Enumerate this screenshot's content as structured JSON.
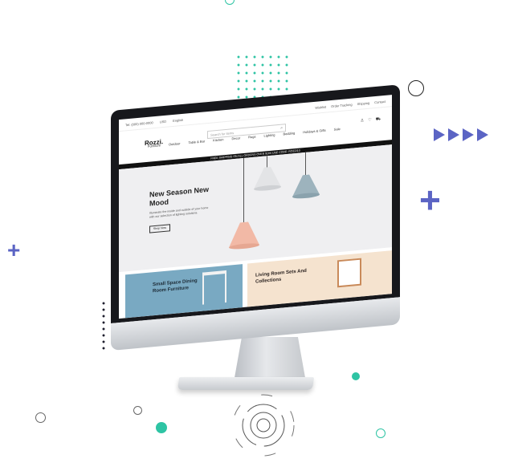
{
  "colors": {
    "accent_teal": "#2ec4a4",
    "accent_indigo": "#5b64c4",
    "dark": "#1f1f2e",
    "promo_bar": "#111111",
    "card_blue": "#79a9c2",
    "card_peach": "#f5e3cf"
  },
  "decor": {
    "x_mark": "✖",
    "plus": "+",
    "icons": [
      "close-icon",
      "plus-icon",
      "chevron-right-icon",
      "play-arrow-icon",
      "circle-icon",
      "target-icon"
    ]
  },
  "site": {
    "topbar": {
      "phone": "Tel: (000) 000-0000",
      "currency": "USD",
      "language": "English",
      "links": [
        "Wishlist",
        "Order Tracking",
        "Shipping",
        "Contact"
      ]
    },
    "logo": "Rozzi.",
    "search_placeholder": "Search for items",
    "nav": [
      "Furniture",
      "Outdoor",
      "Table & Bar",
      "Kitchen",
      "Decor",
      "Rugs",
      "Lighting",
      "Bedding",
      "Holidays & Gifts",
      "Sale"
    ],
    "promo": "FREE SHIPPING ON ALL ORDERS OVER $100  USE CODE: ROZZI10",
    "hero": {
      "title": "New Season New Mood",
      "subtitle": "Illuminate the inside and outside of your home with our selection of lighting solutions.",
      "button": "Shop Now"
    },
    "cards": [
      {
        "title": "Small Space Dining Room Furniture"
      },
      {
        "title": "Living Room Sets And Collections"
      }
    ]
  }
}
